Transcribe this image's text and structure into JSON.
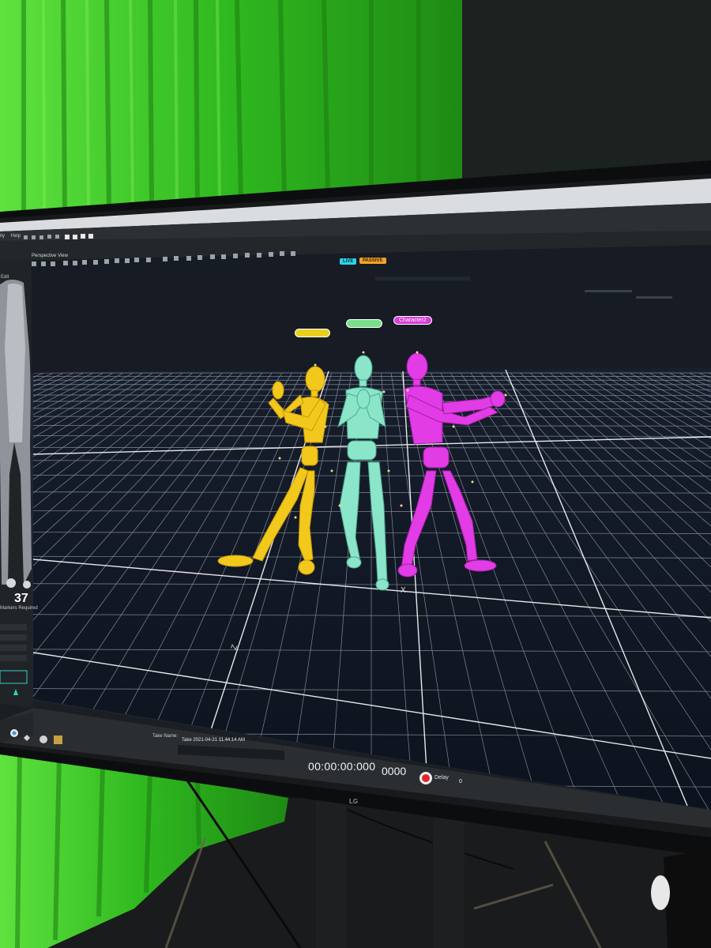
{
  "menu": {
    "items": [
      "ity",
      "Help"
    ]
  },
  "viewport": {
    "title": "Perspective View",
    "edit_label": "Edit"
  },
  "mode_badges": {
    "live": "LIVE",
    "passive": "PASSIVE"
  },
  "characters": [
    {
      "name": "",
      "color": "#f2c81c"
    },
    {
      "name": "",
      "color": "#7fe0b8"
    },
    {
      "name": "Character2",
      "color": "#e23ce6"
    }
  ],
  "side_panel": {
    "marker_count": "37",
    "markers_label": "Markers Required"
  },
  "take": {
    "label": "Take Name:",
    "value": "Take 2021-04-21 11.44.14 AM"
  },
  "transport": {
    "timecode": "00:00:00:000",
    "frame": "0000",
    "delay_label": "Delay",
    "delay_value": "0"
  },
  "monitor": {
    "brand": "LG"
  },
  "axes": {
    "x": "X",
    "z": "Z"
  },
  "colors": {
    "green_screen": "#3fcf2c",
    "grid": "#dfe6ee",
    "record": "#e0262d"
  }
}
